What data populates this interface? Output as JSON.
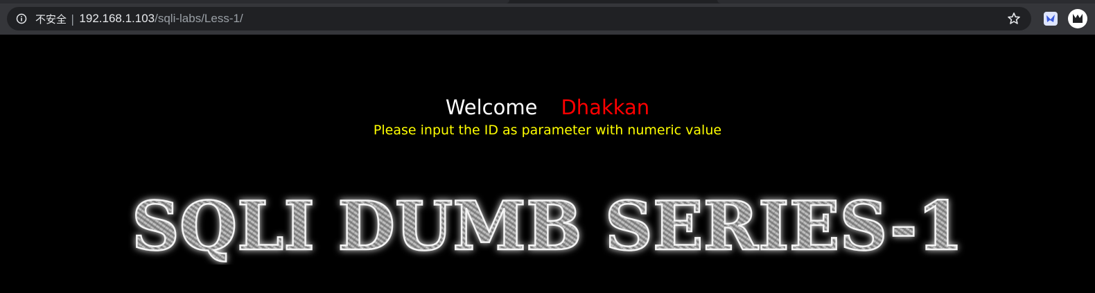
{
  "browser": {
    "security_label": "不安全",
    "separator": "|",
    "url_host": "192.168.1.103",
    "url_path": "/sqli-labs/Less-1/",
    "icons": [
      "info-icon",
      "star-icon",
      "extension-icon",
      "profile-extension-icon"
    ]
  },
  "page": {
    "welcome": "Welcome",
    "name": "Dhakkan",
    "instruction": "Please input the ID as parameter with numeric value",
    "banner_text": "SQLI DUMB SERIES-1",
    "colors": {
      "background": "#000000",
      "welcome": "#ffffff",
      "name": "#ff0000",
      "instruction": "#ffff00"
    }
  }
}
